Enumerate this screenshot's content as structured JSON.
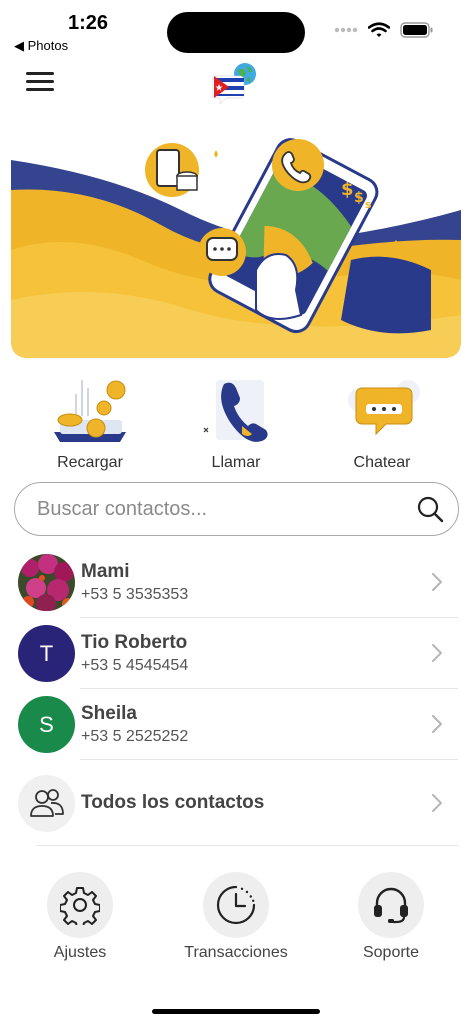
{
  "status": {
    "time": "1:26",
    "back_label": "◀ Photos"
  },
  "actions": [
    {
      "label": "Recargar",
      "icon": "recharge-coins-icon"
    },
    {
      "label": "Llamar",
      "icon": "phone-call-icon"
    },
    {
      "label": "Chatear",
      "icon": "chat-bubble-icon"
    }
  ],
  "search": {
    "placeholder": "Buscar contactos...",
    "value": ""
  },
  "contacts": [
    {
      "name": "Mami",
      "phone": "+53 5 3535353",
      "avatar": "photo"
    },
    {
      "name": "Tio Roberto",
      "phone": "+53 5 4545454",
      "initial": "T",
      "color": "#2a2478"
    },
    {
      "name": "Sheila",
      "phone": "+53 5 2525252",
      "initial": "S",
      "color": "#1a8a4a"
    }
  ],
  "all_contacts_label": "Todos los contactos",
  "bottom_nav": [
    {
      "label": "Ajustes",
      "icon": "gear-icon"
    },
    {
      "label": "Transacciones",
      "icon": "history-clock-icon"
    },
    {
      "label": "Soporte",
      "icon": "headset-icon"
    }
  ],
  "colors": {
    "accent_yellow": "#f4b82a",
    "accent_navy": "#2a3a8a",
    "text": "#333333"
  }
}
